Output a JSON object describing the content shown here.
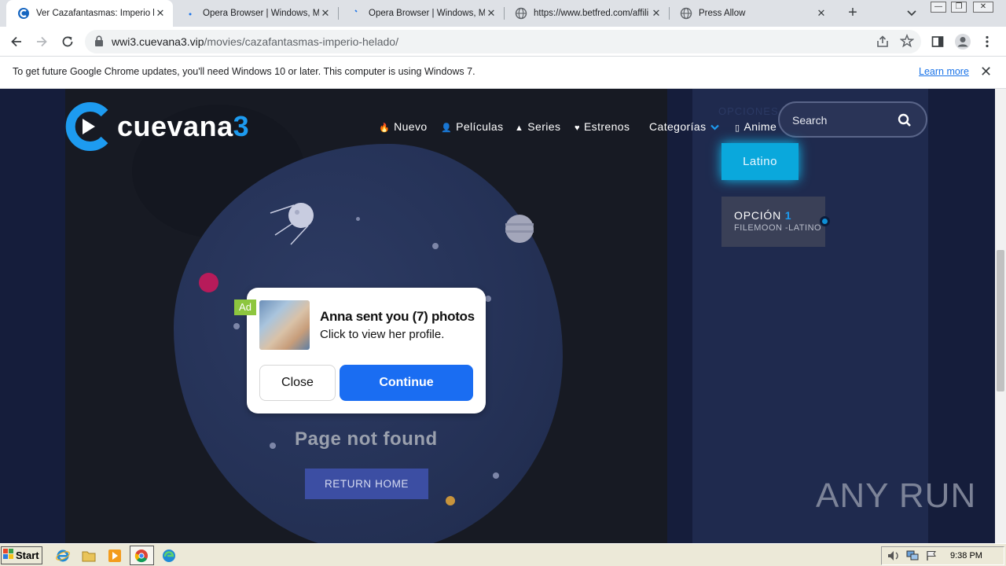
{
  "tabs": [
    {
      "title": "Ver Cazafantasmas: Imperio h",
      "close": "✕",
      "favicon": "cuevana-icon",
      "active": true
    },
    {
      "title": "Opera Browser | Windows, Ma",
      "close": "✕",
      "favicon": "loading-dot-icon"
    },
    {
      "title": "Opera Browser | Windows, Ma",
      "close": "✕",
      "favicon": "loading-dot-icon"
    },
    {
      "title": "https://www.betfred.com/affili",
      "close": "✕",
      "favicon": "globe-icon"
    },
    {
      "title": "Press Allow",
      "close": "✕",
      "favicon": "globe-icon"
    }
  ],
  "new_tab": "+",
  "window_controls": [
    "—",
    "❐",
    "✕"
  ],
  "address_bar": {
    "host": "wwi3.cuevana3.vip",
    "path": "/movies/cazafantasmas-imperio-helado/"
  },
  "infobar": {
    "message": "To get future Google Chrome updates, you'll need Windows 10 or later. This computer is using Windows 7.",
    "link": "Learn more",
    "close": "✕"
  },
  "site": {
    "logo_text": "cuevana",
    "logo_number": "3",
    "nav": [
      {
        "icon": "flame-icon",
        "glyph": "🔥",
        "label": "Nuevo"
      },
      {
        "icon": "person-icon",
        "glyph": "👤",
        "label": "Películas"
      },
      {
        "icon": "triangle-icon",
        "glyph": "▲",
        "label": "Series"
      },
      {
        "icon": "heart-icon",
        "glyph": "♥",
        "label": "Estrenos"
      },
      {
        "icon": "chevron-down-icon",
        "glyph": "⌄",
        "label": "Categorías"
      },
      {
        "icon": "box-icon",
        "glyph": "▯",
        "label": "Anime"
      }
    ],
    "search_placeholder": "Search",
    "options_heading": "OPCIONES",
    "language_button": "Latino",
    "option_card": {
      "label": "OPCIÓN",
      "number": "1",
      "subtitle": "FILEMOON -LATINO"
    },
    "not_found": "Page not found",
    "return_home": "RETURN HOME"
  },
  "ad_popup": {
    "badge": "Ad",
    "headline": "Anna sent you (7) photos",
    "subtext": "Click to view her profile.",
    "close_label": "Close",
    "continue_label": "Continue"
  },
  "watermark": "ANY RUN",
  "taskbar": {
    "start_label": "Start",
    "clock": "9:38 PM"
  },
  "colors": {
    "page_bg": "#151d3b",
    "accent_blue": "#1d9bf0",
    "latino_button": "#0aa8dc",
    "continue_button": "#1a6df2",
    "return_button": "#3c4ea3",
    "ad_badge": "#8dc63f"
  }
}
